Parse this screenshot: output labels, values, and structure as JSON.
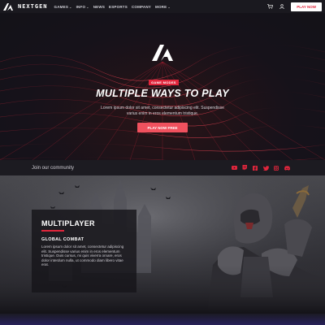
{
  "nav": {
    "brand": "NEXTGEN",
    "items": [
      {
        "label": "GAMES",
        "caret": "⌄"
      },
      {
        "label": "INFO",
        "caret": "⌄"
      },
      {
        "label": "NEWS",
        "caret": ""
      },
      {
        "label": "ESPORTS",
        "caret": ""
      },
      {
        "label": "COMPANY",
        "caret": ""
      },
      {
        "label": "MORE",
        "caret": "⌄"
      }
    ],
    "cta": "PLAY NOW"
  },
  "hero": {
    "tag": "GAME MODES",
    "title": "MULTIPLE WAYS TO PLAY",
    "description": "Lorem ipsum dolor sit amet, consectetur adipiscing elit. Suspendisse varius enim in eros elementum tristique.",
    "button": "PLAY NOW FREE"
  },
  "community": {
    "label": "Join our community",
    "socials": [
      "youtube-icon",
      "twitch-icon",
      "facebook-icon",
      "twitter-icon",
      "instagram-icon",
      "discord-icon"
    ]
  },
  "feature": {
    "title": "MULTIPLAYER",
    "subtitle": "GLOBAL COMBAT",
    "body": "Lorem ipsum dolor sit amet, consectetur adipiscing elit. Suspendisse varius enim in eros elementum tristique. Duis cursus, mi quis viverra ornare, eros dolor interdum nulla, ut commodo diam libero vitae erat."
  },
  "colors": {
    "accent": "#e1263c",
    "button": "#f0515e",
    "nav_bg": "#1a191f"
  }
}
